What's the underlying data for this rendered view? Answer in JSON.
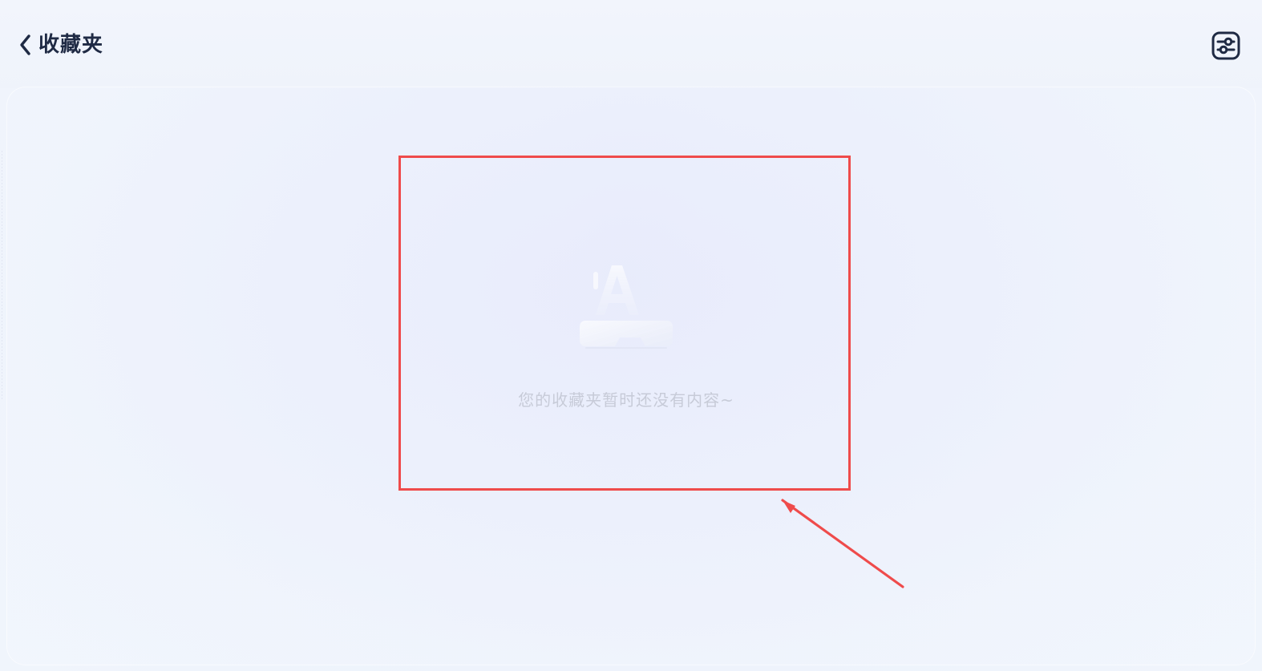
{
  "header": {
    "title": "收藏夹",
    "back_icon": "chevron-left-icon",
    "settings_icon": "sliders-icon"
  },
  "empty_state": {
    "message": "您的收藏夹暂时还没有内容~",
    "illustration_icon": "empty-folder-icon"
  },
  "annotation": {
    "box_color": "#ef4b4b",
    "arrow_color": "#ef4b4b"
  }
}
